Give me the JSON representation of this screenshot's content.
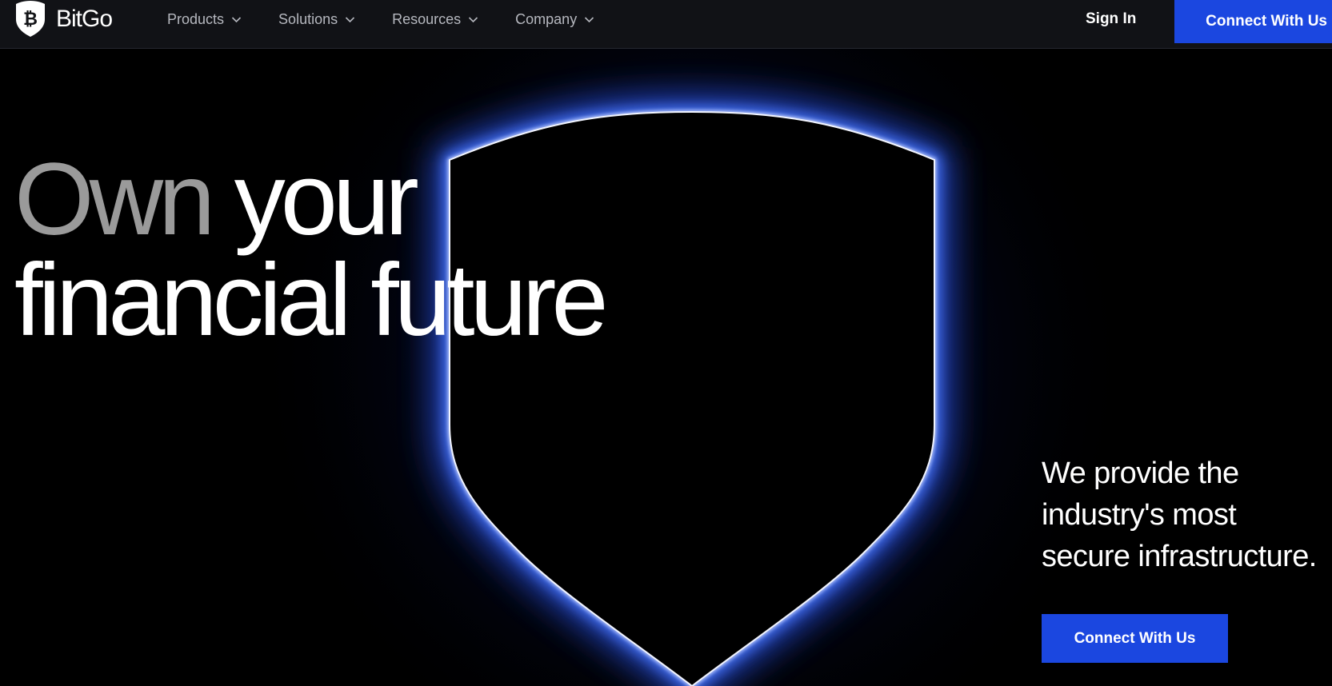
{
  "brand": {
    "name": "BitGo",
    "logo_icon": "bitcoin-shield-icon"
  },
  "nav": {
    "menu": [
      {
        "label": "Products",
        "icon": "chevron-down-icon"
      },
      {
        "label": "Solutions",
        "icon": "chevron-down-icon"
      },
      {
        "label": "Resources",
        "icon": "chevron-down-icon"
      },
      {
        "label": "Company",
        "icon": "chevron-down-icon"
      }
    ],
    "sign_in": "Sign In",
    "cta": "Connect With Us"
  },
  "hero": {
    "headline_word1": "Own",
    "headline_word2": "your",
    "headline_line2": "financial future",
    "tagline_lines": [
      "We provide the",
      "industry's most",
      "secure infrastructure."
    ],
    "cta": "Connect With Us",
    "graphic": "glowing-shield"
  },
  "colors": {
    "nav_bg": "#111216",
    "accent_blue": "#1b47e0",
    "glow_blue": "#2f5bff",
    "headline_muted": "#9a9a9a"
  }
}
